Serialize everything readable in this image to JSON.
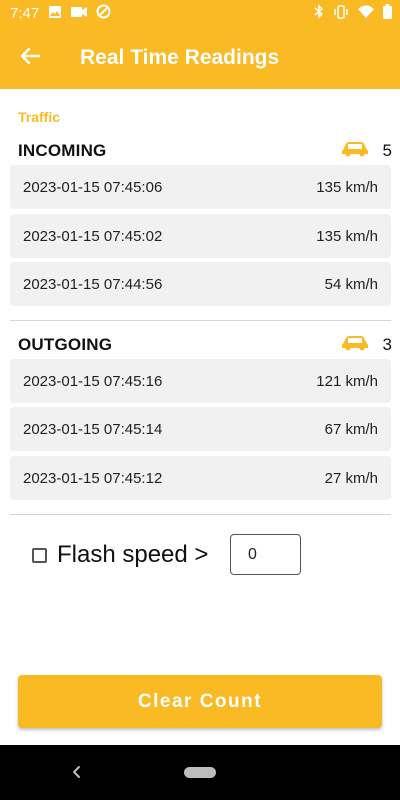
{
  "status_bar": {
    "time": "7:47",
    "left_icons": [
      "image-icon",
      "video-camera-icon",
      "circle-dnd-icon"
    ],
    "right_icons": [
      "bluetooth-icon",
      "vibrate-icon",
      "wifi-icon",
      "battery-icon"
    ]
  },
  "app_bar": {
    "title": "Real Time Readings",
    "back_icon": "arrow-left-icon"
  },
  "traffic_label": "Traffic",
  "incoming": {
    "title": "INCOMING",
    "count": "5",
    "icon": "car-icon",
    "readings": [
      {
        "time": "2023-01-15 07:45:06",
        "speed": "135 km/h"
      },
      {
        "time": "2023-01-15 07:45:02",
        "speed": "135 km/h"
      },
      {
        "time": "2023-01-15 07:44:56",
        "speed": "54 km/h"
      }
    ]
  },
  "outgoing": {
    "title": "OUTGOING",
    "count": "3",
    "icon": "car-icon",
    "readings": [
      {
        "time": "2023-01-15 07:45:16",
        "speed": "121 km/h"
      },
      {
        "time": "2023-01-15 07:45:14",
        "speed": "67 km/h"
      },
      {
        "time": "2023-01-15 07:45:12",
        "speed": "27 km/h"
      }
    ]
  },
  "flash": {
    "label": "Flash speed >",
    "checked": false,
    "value": "0"
  },
  "clear_button": "Clear Count",
  "colors": {
    "accent": "#F9BA24",
    "row_bg": "#F1F1F1"
  }
}
